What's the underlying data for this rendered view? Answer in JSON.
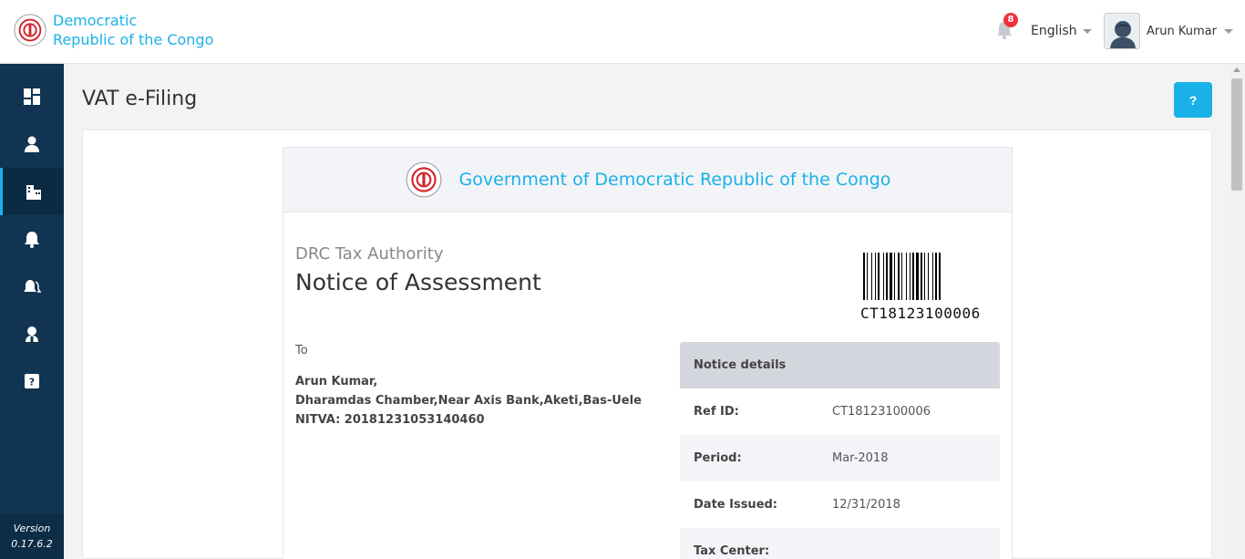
{
  "header": {
    "brand_line1": "Democratic",
    "brand_line2": "Republic of the Congo",
    "notification_count": "8",
    "language": "English",
    "user_name": "Arun Kumar"
  },
  "sidebar": {
    "items": [
      {
        "icon": "dashboard-icon"
      },
      {
        "icon": "user-icon"
      },
      {
        "icon": "building-icon",
        "active": true
      },
      {
        "icon": "bell-icon"
      },
      {
        "icon": "bells-icon"
      },
      {
        "icon": "support-agent-icon"
      },
      {
        "icon": "help-box-icon"
      }
    ],
    "version_label": "Version",
    "version_number": "0.17.6.2"
  },
  "page": {
    "title": "VAT e-Filing",
    "help_label": "?"
  },
  "notice": {
    "gov_title": "Government of Democratic Republic of the Congo",
    "authority": "DRC Tax Authority",
    "doc_title": "Notice of Assessment",
    "barcode_number": "CT18123100006",
    "to_label": "To",
    "recipient_name": "Arun Kumar,",
    "recipient_address": "Dharamdas Chamber,Near Axis Bank,Aketi,Bas-Uele",
    "recipient_nitva": "NITVA: 20181231053140460",
    "details_title": "Notice details",
    "details": [
      {
        "label": "Ref ID:",
        "value": "CT18123100006"
      },
      {
        "label": "Period:",
        "value": "Mar-2018"
      },
      {
        "label": "Date Issued:",
        "value": "12/31/2018"
      },
      {
        "label": "Tax Center:",
        "value": ""
      }
    ]
  },
  "colors": {
    "accent": "#1ab1e8",
    "sidebar": "#103452",
    "badge": "#f0323c"
  }
}
